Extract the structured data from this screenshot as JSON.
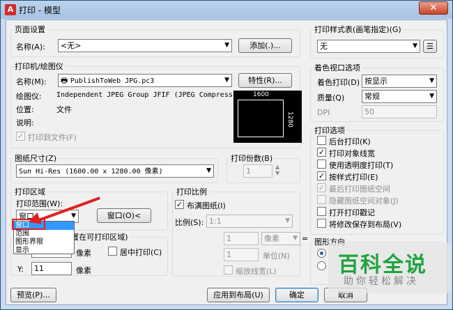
{
  "window": {
    "title": "打印 - 模型",
    "app_icon": "A",
    "close": "✕"
  },
  "page_setup": {
    "group": "页面设置",
    "name_label": "名称(A):",
    "name_value": "<无>",
    "add_button": "添加(.)..."
  },
  "printer": {
    "group": "打印机/绘图仪",
    "name_label": "名称(M):",
    "name_value": "PublishToWeb JPG.pc3",
    "props_button": "特性(R)...",
    "plotter_label": "绘图仪:",
    "plotter_value": "Independent JPEG Group JFIF (JPEG Compressi...",
    "location_label": "位置:",
    "location_value": "文件",
    "desc_label": "说明:",
    "print_to_file": "打印到文件(F)",
    "preview_width": "1600",
    "preview_height": "1280"
  },
  "paper": {
    "group": "图纸尺寸(Z)",
    "value": "Sun Hi-Res (1600.00 x 1280.00 像素)"
  },
  "copies": {
    "group": "打印份数(B)",
    "value": "1"
  },
  "area": {
    "group": "打印区域",
    "range_label": "打印范围(W):",
    "range_value": "窗口",
    "window_button": "窗口(O)<",
    "dropdown_options": [
      "窗口",
      "范围",
      "图形界限",
      "显示"
    ],
    "offset_partial": "打印偏移(原点设置在可打印区域)",
    "x_label": "X:",
    "y_label": "Y:",
    "y_value": "11",
    "unit_x": "像素",
    "unit_y": "像素",
    "center": "居中打印(C)"
  },
  "scale": {
    "group": "打印比例",
    "fit": "布满图纸(I)",
    "ratio_label": "比例(S):",
    "ratio_value": "1:1",
    "val1": "1",
    "unit1": "像素",
    "val2": "1",
    "unit2": "单位(N)",
    "equals": "=",
    "lineweights": "缩放线宽(L)"
  },
  "style_table": {
    "group": "打印样式表(画笔指定)(G)",
    "value": "无"
  },
  "shaded": {
    "group": "着色视口选项",
    "shade_label": "着色打印(D)",
    "shade_value": "按显示",
    "quality_label": "质量(Q)",
    "quality_value": "常规",
    "dpi_label": "DPI",
    "dpi_value": "50"
  },
  "options": {
    "group": "打印选项",
    "items": [
      {
        "label": "后台打印(K)",
        "checked": false,
        "disabled": false
      },
      {
        "label": "打印对象线宽",
        "checked": true,
        "disabled": false
      },
      {
        "label": "使用透明度打印(T)",
        "checked": false,
        "disabled": false
      },
      {
        "label": "按样式打印(E)",
        "checked": true,
        "disabled": false
      },
      {
        "label": "最后打印图纸空间",
        "checked": true,
        "disabled": true
      },
      {
        "label": "隐藏图纸空间对象(J)",
        "checked": false,
        "disabled": true
      },
      {
        "label": "打开打印戳记",
        "checked": false,
        "disabled": false
      },
      {
        "label": "将修改保存到布局(V)",
        "checked": false,
        "disabled": false
      }
    ]
  },
  "orientation": {
    "group": "图形方向"
  },
  "footer": {
    "preview": "预览(P)...",
    "apply": "应用到布局(U)",
    "ok": "确定",
    "cancel": "取消"
  },
  "watermark": {
    "main": "百科全说",
    "sub": "助你轻松解决"
  },
  "colors": {
    "red_annotation": "#e02020",
    "selection": "#3399ff",
    "watermark_green": "#1da33f"
  }
}
